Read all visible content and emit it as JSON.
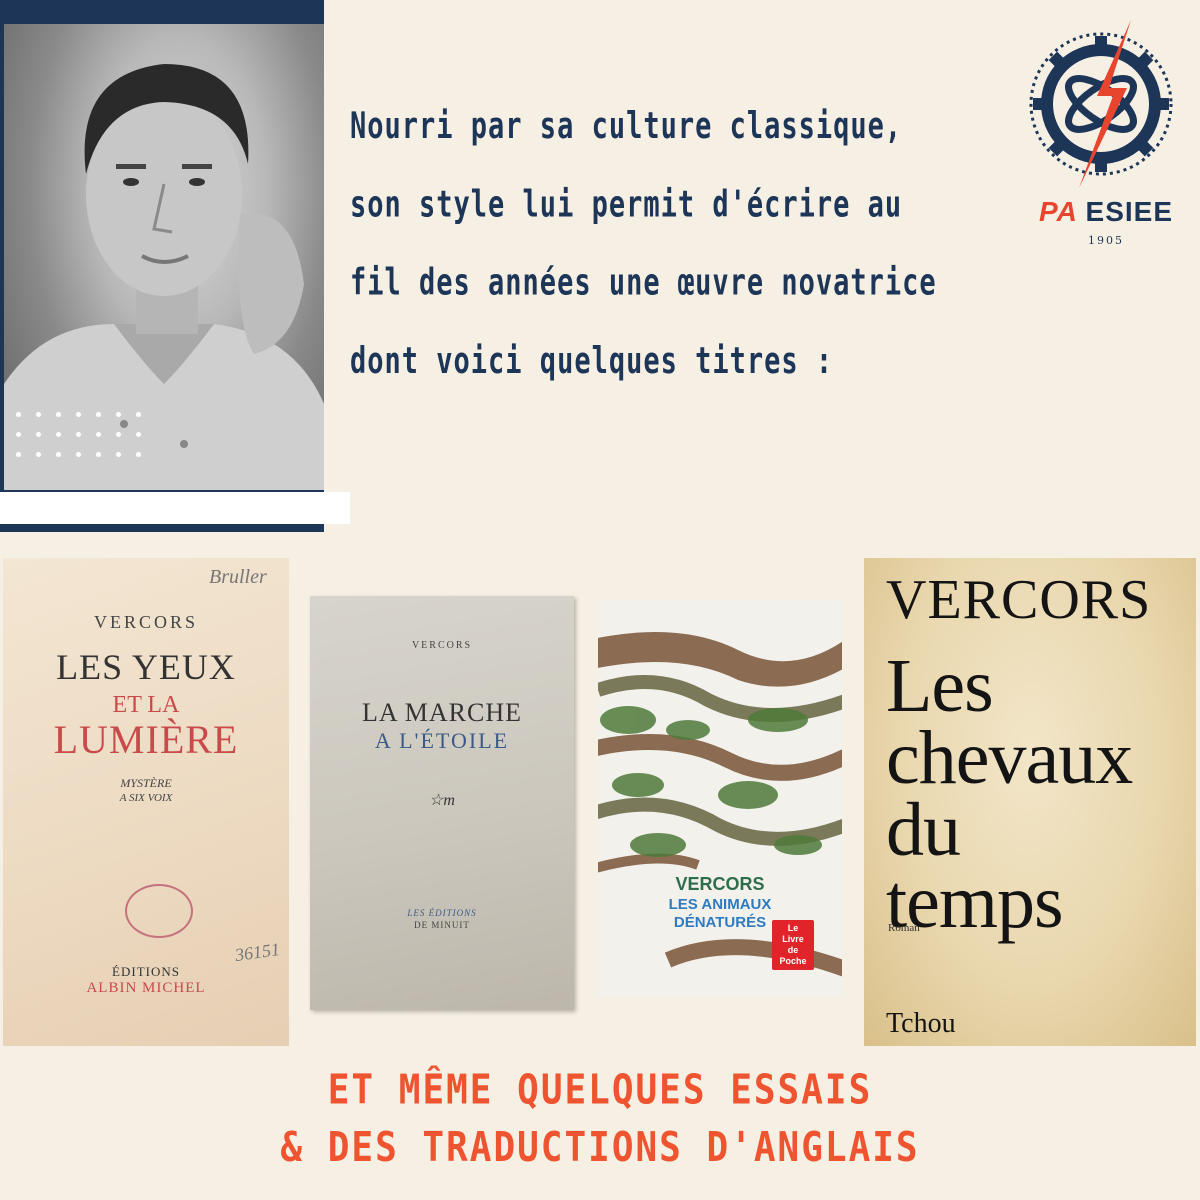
{
  "intro": {
    "lines": [
      "Nourri par sa culture classique,",
      "son style lui permit d'écrire au",
      "fil des années une œuvre novatrice",
      "dont voici quelques titres :"
    ]
  },
  "logo": {
    "brand_prefix": "PA",
    "brand_name": "ESIEE",
    "year": "1905",
    "icon": "gear-atom-logo-icon"
  },
  "books": [
    {
      "author": "VERCORS",
      "title_line1": "LES YEUX",
      "title_line2": "ET LA",
      "title_line3": "LUMIÈRE",
      "subtitle_line1": "MYSTÈRE",
      "subtitle_line2": "A SIX VOIX",
      "publisher_line1": "ÉDITIONS",
      "publisher_line2": "ALBIN MICHEL",
      "handwriting_top": "Bruller",
      "handwriting_bottom": "36151"
    },
    {
      "author": "VERCORS",
      "title_line1": "LA MARCHE",
      "title_line2": "A L'ÉTOILE",
      "mark": "☆m",
      "publisher_line1": "LES ÉDITIONS",
      "publisher_line2": "DE MINUIT"
    },
    {
      "author": "VERCORS",
      "title_line1": "LES ANIMAUX",
      "title_line2": "DÉNATURÉS",
      "badge_line1": "Le",
      "badge_line2": "Livre",
      "badge_line3": "de",
      "badge_line4": "Poche"
    },
    {
      "author": "VERCORS",
      "title_line1": "Les",
      "title_line2": "chevaux",
      "title_line3": "du",
      "title_line4": "temps",
      "genre": "Roman",
      "publisher": "Tchou"
    }
  ],
  "caption": {
    "line1": "ET MÊME QUELQUES ESSAIS",
    "line2": "& DES TRADUCTIONS D'ANGLAIS"
  },
  "colors": {
    "background": "#f6efe3",
    "navy": "#1d3557",
    "accent_orange": "#ee5430",
    "logo_red": "#e8452e"
  }
}
